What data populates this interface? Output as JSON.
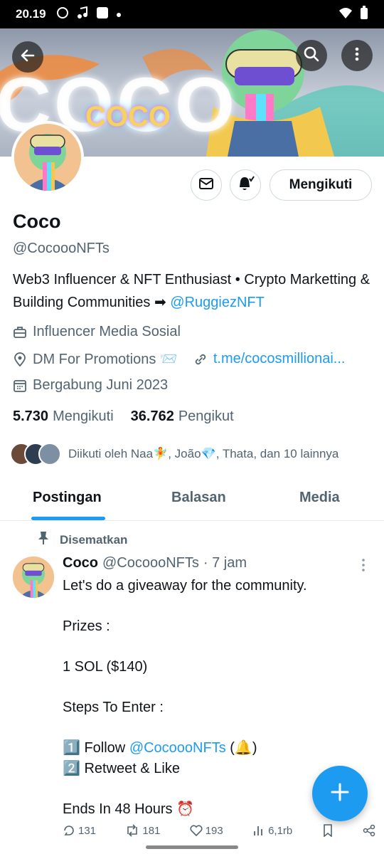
{
  "status_bar": {
    "time": "20.19"
  },
  "banner": {
    "text": "COCO",
    "sub_text": "COCO"
  },
  "profile": {
    "name": "Coco",
    "handle": "@CocoooNFTs",
    "follow_label": "Mengikuti",
    "bio_text": "Web3 Influencer & NFT Enthusiast • Crypto Marketting & Building Communities ➡",
    "bio_link": "@RuggiezNFT",
    "category": "Influencer Media Sosial",
    "location": "DM For Promotions 📨",
    "website": "t.me/cocosmillionai...",
    "joined": "Bergabung Juni 2023",
    "following_count": "5.730",
    "following_label": "Mengikuti",
    "followers_count": "36.762",
    "followers_label": "Pengikut",
    "followed_by": "Diikuti oleh Naa🧚, João💎, Thata, dan 10 lainnya"
  },
  "tabs": [
    {
      "label": "Postingan"
    },
    {
      "label": "Balasan"
    },
    {
      "label": "Media"
    }
  ],
  "post": {
    "pinned_label": "Disematkan",
    "author_name": "Coco",
    "author_handle": "@CocoooNFTs",
    "time": "· 7 jam",
    "body_intro": "Let's do a giveaway for the community.\n\nPrizes :\n\n 1 SOL ($140)\n\nSteps To Enter :\n\n",
    "step1_prefix": "1️⃣ Follow ",
    "step1_link": "@CocoooNFTs",
    "step1_suffix": " (🔔)",
    "body_rest": "2️⃣ Retweet & Like\n\nEnds In 48 Hours ⏰",
    "replies": "131",
    "retweets": "181",
    "likes": "193",
    "views": "6,1rb"
  },
  "colors": {
    "accent": "#1d9bf0",
    "muted": "#536471"
  }
}
